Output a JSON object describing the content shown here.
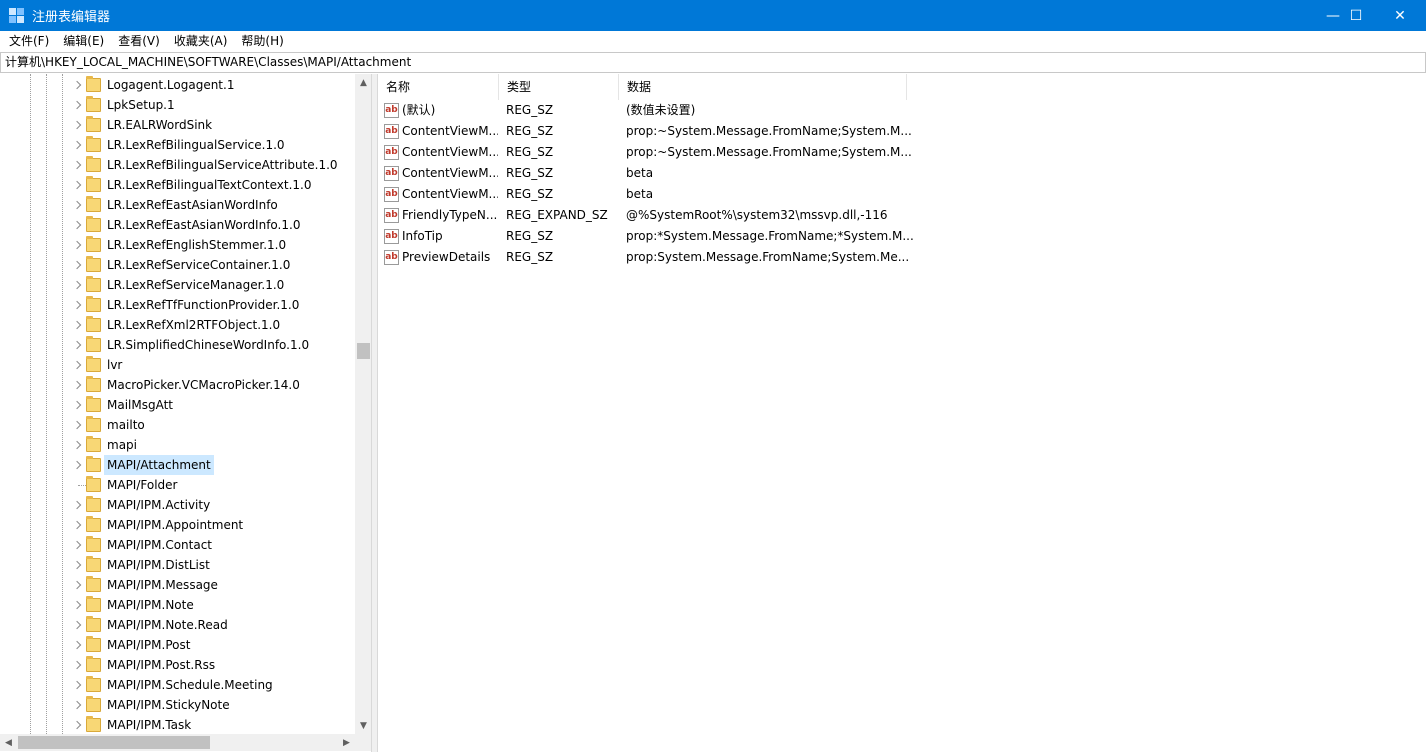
{
  "window": {
    "title": "注册表编辑器",
    "minimize_glyph": "—",
    "maximize_glyph": "☐",
    "close_glyph": "✕"
  },
  "menu": [
    "文件(F)",
    "编辑(E)",
    "查看(V)",
    "收藏夹(A)",
    "帮助(H)"
  ],
  "address": "计算机\\HKEY_LOCAL_MACHINE\\SOFTWARE\\Classes\\MAPI/Attachment",
  "tree": {
    "items": [
      {
        "label": "Logagent.Logagent.1",
        "expandable": true,
        "selected": false
      },
      {
        "label": "LpkSetup.1",
        "expandable": true,
        "selected": false
      },
      {
        "label": "LR.EALRWordSink",
        "expandable": true,
        "selected": false
      },
      {
        "label": "LR.LexRefBilingualService.1.0",
        "expandable": true,
        "selected": false
      },
      {
        "label": "LR.LexRefBilingualServiceAttribute.1.0",
        "expandable": true,
        "selected": false
      },
      {
        "label": "LR.LexRefBilingualTextContext.1.0",
        "expandable": true,
        "selected": false
      },
      {
        "label": "LR.LexRefEastAsianWordInfo",
        "expandable": true,
        "selected": false
      },
      {
        "label": "LR.LexRefEastAsianWordInfo.1.0",
        "expandable": true,
        "selected": false
      },
      {
        "label": "LR.LexRefEnglishStemmer.1.0",
        "expandable": true,
        "selected": false
      },
      {
        "label": "LR.LexRefServiceContainer.1.0",
        "expandable": true,
        "selected": false
      },
      {
        "label": "LR.LexRefServiceManager.1.0",
        "expandable": true,
        "selected": false
      },
      {
        "label": "LR.LexRefTfFunctionProvider.1.0",
        "expandable": true,
        "selected": false
      },
      {
        "label": "LR.LexRefXml2RTFObject.1.0",
        "expandable": true,
        "selected": false
      },
      {
        "label": "LR.SimplifiedChineseWordInfo.1.0",
        "expandable": true,
        "selected": false
      },
      {
        "label": "lvr",
        "expandable": true,
        "selected": false
      },
      {
        "label": "MacroPicker.VCMacroPicker.14.0",
        "expandable": true,
        "selected": false
      },
      {
        "label": "MailMsgAtt",
        "expandable": true,
        "selected": false
      },
      {
        "label": "mailto",
        "expandable": true,
        "selected": false
      },
      {
        "label": "mapi",
        "expandable": true,
        "selected": false
      },
      {
        "label": "MAPI/Attachment",
        "expandable": true,
        "selected": true
      },
      {
        "label": "MAPI/Folder",
        "expandable": false,
        "selected": false
      },
      {
        "label": "MAPI/IPM.Activity",
        "expandable": true,
        "selected": false
      },
      {
        "label": "MAPI/IPM.Appointment",
        "expandable": true,
        "selected": false
      },
      {
        "label": "MAPI/IPM.Contact",
        "expandable": true,
        "selected": false
      },
      {
        "label": "MAPI/IPM.DistList",
        "expandable": true,
        "selected": false
      },
      {
        "label": "MAPI/IPM.Message",
        "expandable": true,
        "selected": false
      },
      {
        "label": "MAPI/IPM.Note",
        "expandable": true,
        "selected": false
      },
      {
        "label": "MAPI/IPM.Note.Read",
        "expandable": true,
        "selected": false
      },
      {
        "label": "MAPI/IPM.Post",
        "expandable": true,
        "selected": false
      },
      {
        "label": "MAPI/IPM.Post.Rss",
        "expandable": true,
        "selected": false
      },
      {
        "label": "MAPI/IPM.Schedule.Meeting",
        "expandable": true,
        "selected": false
      },
      {
        "label": "MAPI/IPM.StickyNote",
        "expandable": true,
        "selected": false
      },
      {
        "label": "MAPI/IPM.Task",
        "expandable": true,
        "selected": false
      }
    ]
  },
  "values": {
    "columns": [
      "名称",
      "类型",
      "数据"
    ],
    "icon_text": "ab",
    "rows": [
      {
        "name": "(默认)",
        "type": "REG_SZ",
        "data": "(数值未设置)"
      },
      {
        "name": "ContentViewM...",
        "type": "REG_SZ",
        "data": "prop:~System.Message.FromName;System.M..."
      },
      {
        "name": "ContentViewM...",
        "type": "REG_SZ",
        "data": "prop:~System.Message.FromName;System.M..."
      },
      {
        "name": "ContentViewM...",
        "type": "REG_SZ",
        "data": "beta"
      },
      {
        "name": "ContentViewM...",
        "type": "REG_SZ",
        "data": "beta"
      },
      {
        "name": "FriendlyTypeN...",
        "type": "REG_EXPAND_SZ",
        "data": "@%SystemRoot%\\system32\\mssvp.dll,-116"
      },
      {
        "name": "InfoTip",
        "type": "REG_SZ",
        "data": "prop:*System.Message.FromName;*System.M..."
      },
      {
        "name": "PreviewDetails",
        "type": "REG_SZ",
        "data": "prop:System.Message.FromName;System.Me..."
      }
    ]
  },
  "colors": {
    "titlebar": "#0078d7",
    "selection": "#cce8ff",
    "folder": "#f8d775"
  }
}
